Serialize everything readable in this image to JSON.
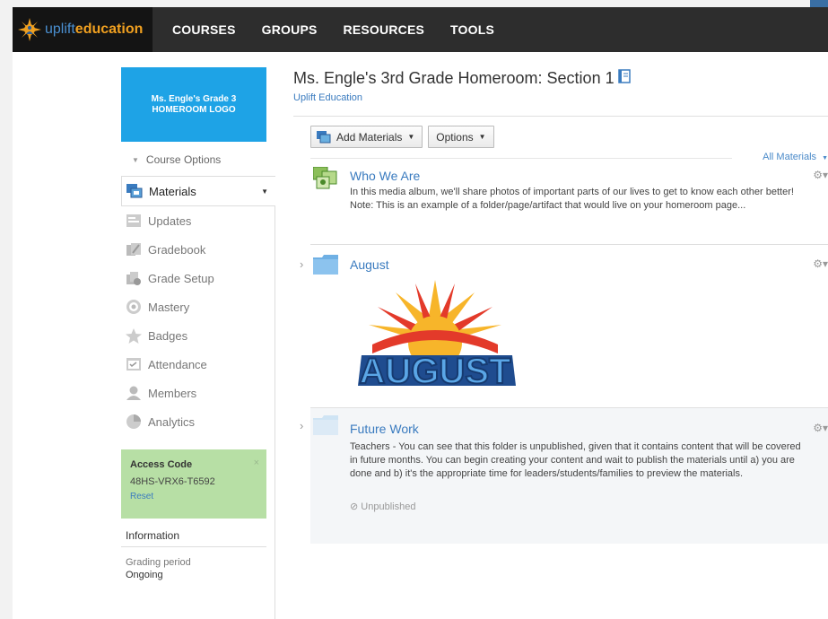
{
  "brand": {
    "logo_part1": "uplift",
    "logo_part2": "education"
  },
  "nav": {
    "courses": "COURSES",
    "groups": "GROUPS",
    "resources": "RESOURCES",
    "tools": "TOOLS"
  },
  "sidebar": {
    "course_logo_line1": "Ms. Engle's Grade 3",
    "course_logo_line2": "HOMEROOM LOGO",
    "course_options": "Course Options",
    "items": [
      {
        "label": "Materials",
        "icon": "materials-icon"
      },
      {
        "label": "Updates",
        "icon": "updates-icon"
      },
      {
        "label": "Gradebook",
        "icon": "gradebook-icon"
      },
      {
        "label": "Grade Setup",
        "icon": "grade-setup-icon"
      },
      {
        "label": "Mastery",
        "icon": "mastery-icon"
      },
      {
        "label": "Badges",
        "icon": "badges-icon"
      },
      {
        "label": "Attendance",
        "icon": "attendance-icon"
      },
      {
        "label": "Members",
        "icon": "members-icon"
      },
      {
        "label": "Analytics",
        "icon": "analytics-icon"
      }
    ],
    "access": {
      "title": "Access Code",
      "code": "48HS-VRX6-T6592",
      "reset": "Reset",
      "close": "×"
    },
    "info": {
      "heading": "Information",
      "label": "Grading period",
      "value": "Ongoing"
    }
  },
  "main": {
    "title": "Ms. Engle's 3rd Grade Homeroom: Section 1",
    "subtitle": "Uplift Education",
    "add_materials": "Add Materials",
    "options": "Options",
    "all_materials": "All Materials",
    "items": [
      {
        "name": "Who We Are",
        "desc1": "In this media album, we'll share photos of important parts of our lives to get to know each other better!",
        "desc2": "Note: This is an example of a folder/page/artifact that would live on your homeroom page..."
      },
      {
        "name": "August",
        "image_text": "AUGUST"
      },
      {
        "name": "Future Work",
        "desc": "Teachers - You can see that this folder is unpublished, given that it contains content that will be covered in future months. You can begin creating your content and wait to publish the materials until a) you are done and b) it's the appropriate time for leaders/students/families to preview the materials.",
        "status": "Unpublished"
      }
    ]
  },
  "colors": {
    "nav_bg": "#2d2d2d",
    "link": "#3a7bbf",
    "logo_box": "#1ea3e6",
    "access_bg": "#b7dfa5"
  }
}
